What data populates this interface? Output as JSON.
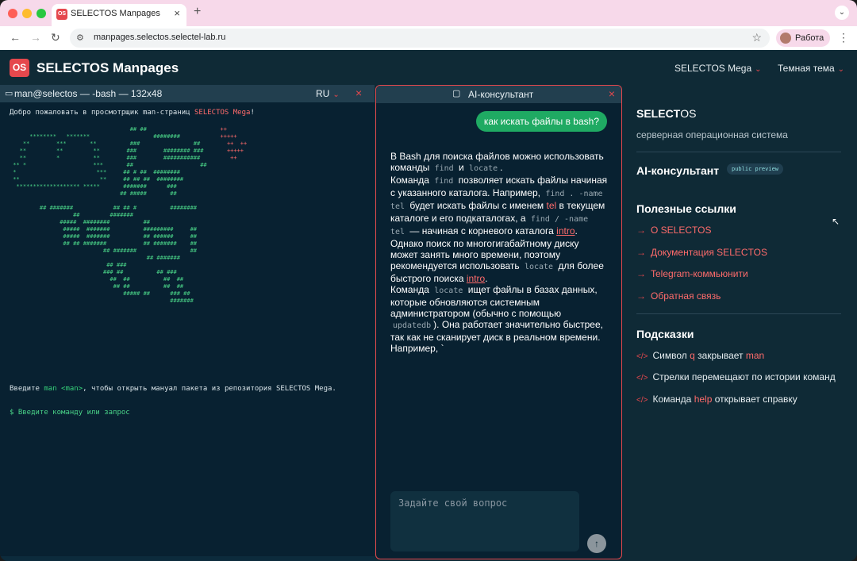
{
  "browser": {
    "tab_title": "SELECTOS Manpages",
    "tab_favicon": "OS",
    "url": "manpages.selectos.selectel-lab.ru",
    "profile_label": "Работа"
  },
  "header": {
    "logo": "OS",
    "title": "SELECTOS Manpages",
    "edition_select": "SELECTOS Mega",
    "theme_select": "Темная тема"
  },
  "terminal": {
    "title": "man@selectos — -bash — 132x48",
    "lang": "RU",
    "welcome_prefix": "Добро пожаловать в просмотрщик man-страниц ",
    "welcome_accent": "SELECTOS Mega",
    "welcome_suffix": "!",
    "hint_prefix": "Введите ",
    "hint_cmd": "man <man>",
    "hint_suffix": ", чтобы открыть мануал пакета из репозитория SELECTOS Mega.",
    "prompt": "$ Введите команду или запрос"
  },
  "ai_panel": {
    "title": "AI-консультант",
    "user_message": "как искать файлы в bash?",
    "answer": {
      "p1a": "В Bash для поиска файлов можно использовать команды ",
      "c_find": "find",
      "p1b": " и ",
      "c_locate": "locate",
      "p1c": ".",
      "p2a": "Команда ",
      "p2b": " позволяет искать файлы начиная с указанного каталога. Например, ",
      "c_find_tel": "find . -name tel",
      "p2c": " будет искать файлы с именем ",
      "w_tel": "tel",
      "p2d": " в текущем каталоге и его подкаталогах, а ",
      "c_find_root": "find / -name tel",
      "p2e": " — начиная с корневого каталога ",
      "w_intro": "intro",
      "p2f": ". Однако поиск по многогигабайтному диску может занять много времени, поэтому рекомендуется использовать ",
      "p2g": " для более быстрого поиска ",
      "p2h": ".",
      "p3a": "Команда ",
      "p3b": " ищет файлы в базах данных, которые обновляются системным администратором (обычно с помощью ",
      "c_updatedb": "updatedb",
      "p3c": "). Она работает значительно быстрее, так как не сканирует диск в реальном времени. Например, `"
    },
    "input_placeholder": "Задайте свой вопрос"
  },
  "sidebar": {
    "brand_bold": "SELECT",
    "brand_rest": "OS",
    "tagline": "серверная операционная система",
    "ai_heading": "AI-консультант",
    "ai_badge": "public preview",
    "links_heading": "Полезные ссылки",
    "links": [
      "О SELECTOS",
      "Документация SELECTOS",
      "Telegram-коммьюнити",
      "Обратная связь"
    ],
    "tips_heading": "Подсказки",
    "tips": [
      {
        "pre": "Символ ",
        "accent": "q",
        "post": " закрывает ",
        "accent2": "man"
      },
      {
        "pre": "Стрелки перемещают по истории команд",
        "accent": "",
        "post": "",
        "accent2": ""
      },
      {
        "pre": "Команда ",
        "accent": "help",
        "post": " открывает справку",
        "accent2": ""
      }
    ]
  },
  "colors": {
    "accent": "#e5484d",
    "link": "#ff6b6b",
    "user_bubble": "#1faa63",
    "terminal_green": "#4ad488",
    "background": "#0f2a36"
  }
}
